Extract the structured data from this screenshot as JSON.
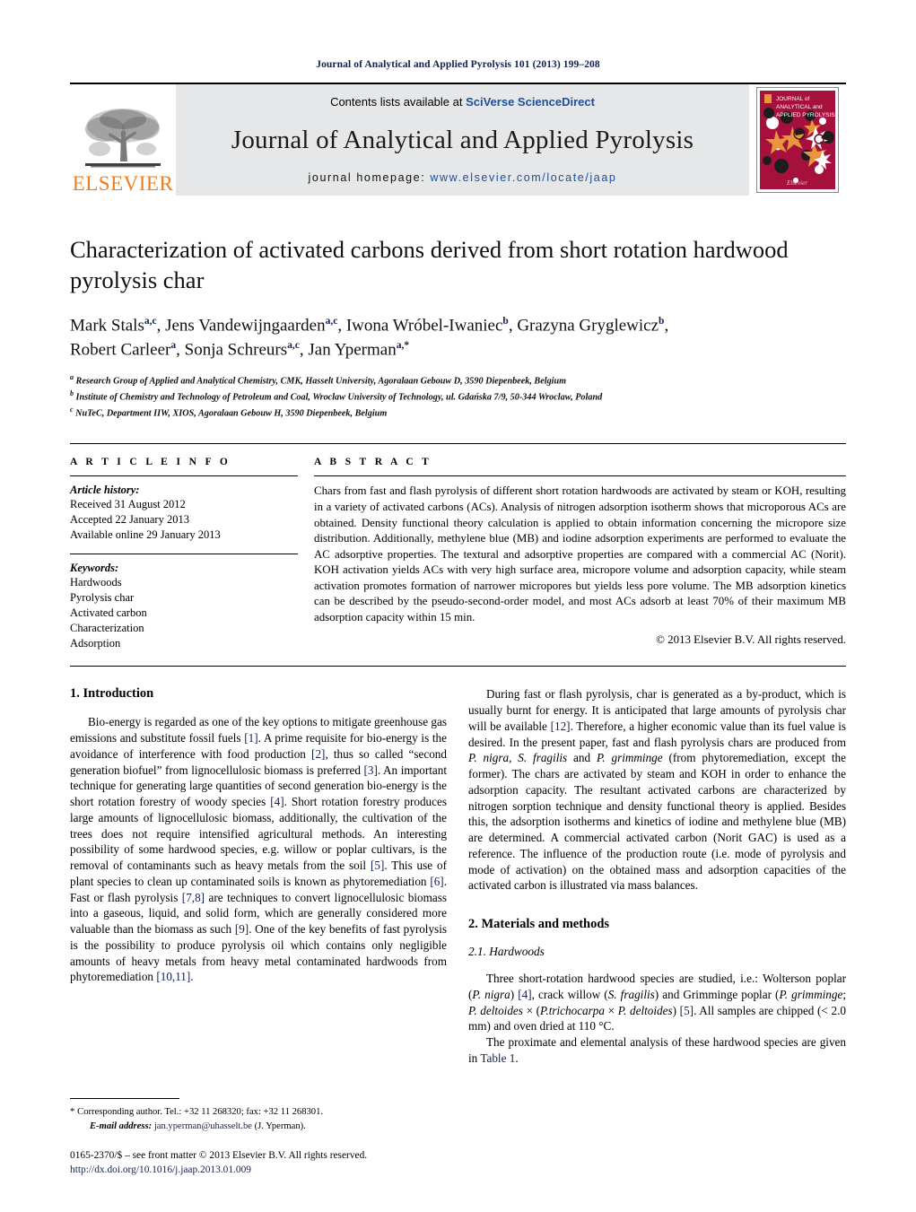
{
  "running_head": "Journal of Analytical and Applied Pyrolysis 101 (2013) 199–208",
  "masthead": {
    "publisher": "ELSEVIER",
    "contents_prefix": "Contents lists available at ",
    "contents_link": "SciVerse ScienceDirect",
    "journal_title": "Journal of Analytical and Applied Pyrolysis",
    "homepage_prefix": "journal homepage: ",
    "homepage_url": "www.elsevier.com/locate/jaap",
    "cover_line1": "JOURNAL of",
    "cover_line2": "ANALYTICAL and",
    "cover_line3": "APPLIED PYROLYSIS",
    "cover_footer": "Elsevier"
  },
  "article": {
    "title": "Characterization of activated carbons derived from short rotation hardwood pyrolysis char",
    "authors_line1": "Mark Stals",
    "authors": [
      {
        "name": "Mark Stals",
        "sup": "a,c"
      },
      {
        "name": "Jens Vandewijngaarden",
        "sup": "a,c"
      },
      {
        "name": "Iwona Wróbel-Iwaniec",
        "sup": "b"
      },
      {
        "name": "Grazyna Gryglewicz",
        "sup": "b"
      },
      {
        "name": "Robert Carleer",
        "sup": "a"
      },
      {
        "name": "Sonja Schreurs",
        "sup": "a,c"
      },
      {
        "name": "Jan Yperman",
        "sup": "a,*"
      }
    ],
    "affiliations": [
      {
        "sup": "a",
        "text": "Research Group of Applied and Analytical Chemistry, CMK, Hasselt University, Agoralaan Gebouw D, 3590 Diepenbeek, Belgium"
      },
      {
        "sup": "b",
        "text": "Institute of Chemistry and Technology of Petroleum and Coal, Wroclaw University of Technology, ul. Gdańska 7/9, 50-344 Wroclaw, Poland"
      },
      {
        "sup": "c",
        "text": "NuTeC, Department IIW, XIOS, Agoralaan Gebouw H, 3590 Diepenbeek, Belgium"
      }
    ]
  },
  "article_info": {
    "heading": "A R T I C L E   I N F O",
    "history_label": "Article history:",
    "history": [
      "Received 31 August 2012",
      "Accepted 22 January 2013",
      "Available online 29 January 2013"
    ],
    "keywords_label": "Keywords:",
    "keywords": [
      "Hardwoods",
      "Pyrolysis char",
      "Activated carbon",
      "Characterization",
      "Adsorption"
    ]
  },
  "abstract": {
    "heading": "A B S T R A C T",
    "text": "Chars from fast and flash pyrolysis of different short rotation hardwoods are activated by steam or KOH, resulting in a variety of activated carbons (ACs). Analysis of nitrogen adsorption isotherm shows that microporous ACs are obtained. Density functional theory calculation is applied to obtain information concerning the micropore size distribution. Additionally, methylene blue (MB) and iodine adsorption experiments are performed to evaluate the AC adsorptive properties. The textural and adsorptive properties are compared with a commercial AC (Norit). KOH activation yields ACs with very high surface area, micropore volume and adsorption capacity, while steam activation promotes formation of narrower micropores but yields less pore volume. The MB adsorption kinetics can be described by the pseudo-second-order model, and most ACs adsorb at least 70% of their maximum MB adsorption capacity within 15 min.",
    "copyright": "© 2013 Elsevier B.V. All rights reserved."
  },
  "sections": {
    "intro_heading": "1.  Introduction",
    "methods_heading": "2.  Materials and methods",
    "hardwoods_heading": "2.1.  Hardwoods"
  },
  "body": {
    "left_p1": "Bio-energy is regarded as one of the key options to mitigate greenhouse gas emissions and substitute fossil fuels [1]. A prime requisite for bio-energy is the avoidance of interference with food production [2], thus so called \"second generation biofuel\" from lignocellulosic biomass is preferred [3]. An important technique for generating large quantities of second generation bio-energy is the short rotation forestry of woody species [4]. Short rotation forestry produces large amounts of lignocellulosic biomass, additionally, the cultivation of the trees does not require intensified agricultural methods. An interesting possibility of some hardwood species, e.g. willow or poplar cultivars, is the removal of contaminants such as heavy metals from the soil [5]. This use of plant species to clean up contaminated soils is known as phytoremediation [6]. Fast or flash pyrolysis [7,8] are techniques to convert lignocellulosic biomass into a gaseous, liquid, and solid form, which are generally considered more valuable than the biomass as such [9]. One of the key benefits of fast pyrolysis is the possibility to produce pyrolysis oil which contains only negligible amounts of heavy metals from heavy metal contaminated hardwoods from phytoremediation [10,11].",
    "right_p1": "During fast or flash pyrolysis, char is generated as a by-product, which is usually burnt for energy. It is anticipated that large amounts of pyrolysis char will be available [12]. Therefore, a higher economic value than its fuel value is desired. In the present paper, fast and flash pyrolysis chars are produced from P. nigra, S. fragilis and P. grimminge (from phytoremediation, except the former). The chars are activated by steam and KOH in order to enhance the adsorption capacity. The resultant activated carbons are characterized by nitrogen sorption technique and density functional theory is applied. Besides this, the adsorption isotherms and kinetics of iodine and methylene blue (MB) are determined. A commercial activated carbon (Norit GAC) is used as a reference. The influence of the production route (i.e. mode of pyrolysis and mode of activation) on the obtained mass and adsorption capacities of the activated carbon is illustrated via mass balances.",
    "right_p2": "Three short-rotation hardwood species are studied, i.e.: Wolterson poplar (P. nigra) [4], crack willow (S. fragilis) and Grimminge poplar (P. grimminge; P. deltoides × (P.trichocarpa × P. deltoides) [5]. All samples are chipped (< 2.0 mm) and oven dried at 110 °C.",
    "right_p3": "The proximate and elemental analysis of these hardwood species are given in Table 1."
  },
  "footnote": {
    "star": "*",
    "corresponding": "Corresponding author. Tel.: +32 11 268320; fax: +32 11 268301.",
    "email_label": "E-mail address:",
    "email": "jan.yperman@uhasselt.be",
    "email_suffix": "(J. Yperman)."
  },
  "issn": {
    "line1": "0165-2370/$ – see front matter © 2013 Elsevier B.V. All rights reserved.",
    "doi": "http://dx.doi.org/10.1016/j.jaap.2013.01.009"
  }
}
